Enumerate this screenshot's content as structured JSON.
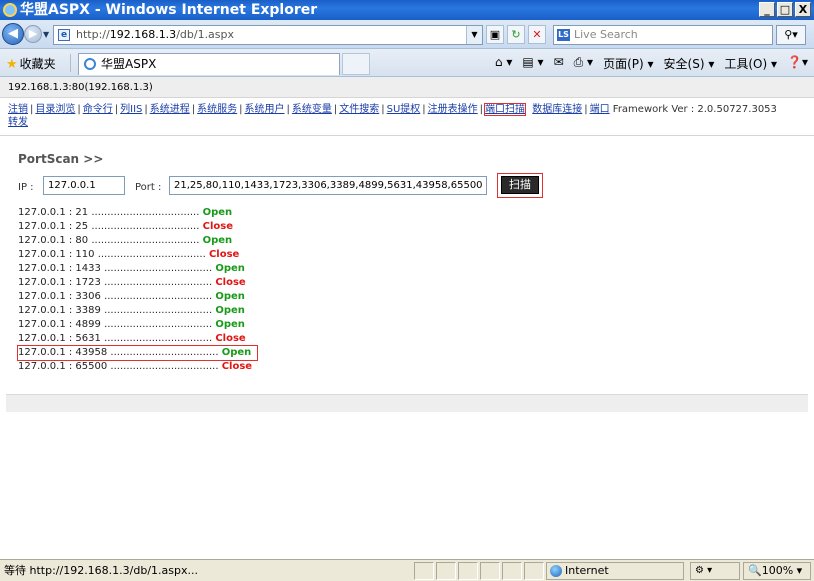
{
  "window": {
    "title": "华盟ASPX - Windows Internet Explorer",
    "min": "_",
    "max": "□",
    "close": "X"
  },
  "address": {
    "url_prefix": "http://",
    "url_host": "192.168.1.3",
    "url_path": "/db/1.aspx",
    "search_placeholder": "Live Search"
  },
  "tabs": {
    "favorites_label": "收藏夹",
    "tab_title": "华盟ASPX",
    "commands": [
      "页面(P) ▾",
      "安全(S) ▾",
      "工具(O) ▾"
    ]
  },
  "page": {
    "host_info": "192.168.1.3:80(192.168.1.3)",
    "menu": [
      "注销",
      "目录浏览",
      "命令行",
      "列IIS",
      "系统进程",
      "系统服务",
      "系统用户",
      "系统变量",
      "文件搜索",
      "SU提权",
      "注册表操作",
      "端口扫描",
      "数据库连接",
      "端口"
    ],
    "framework_version": "Framework Ver : 2.0.50727.3053",
    "menu_last": "转发",
    "scan": {
      "title": "PortScan >>",
      "ip_label": "IP :",
      "ip_value": "127.0.0.1",
      "port_label": "Port :",
      "port_value": "21,25,80,110,1433,1723,3306,3389,4899,5631,43958,65500",
      "button_label": "扫描"
    },
    "results": [
      {
        "target": "127.0.0.1 : 21 ..................................",
        "status": "Open"
      },
      {
        "target": "127.0.0.1 : 25 ..................................",
        "status": "Close"
      },
      {
        "target": "127.0.0.1 : 80 ..................................",
        "status": "Open"
      },
      {
        "target": "127.0.0.1 : 110 ..................................",
        "status": "Close"
      },
      {
        "target": "127.0.0.1 : 1433 ..................................",
        "status": "Open"
      },
      {
        "target": "127.0.0.1 : 1723 ..................................",
        "status": "Close"
      },
      {
        "target": "127.0.0.1 : 3306 ..................................",
        "status": "Open"
      },
      {
        "target": "127.0.0.1 : 3389 ..................................",
        "status": "Open"
      },
      {
        "target": "127.0.0.1 : 4899 ..................................",
        "status": "Open"
      },
      {
        "target": "127.0.0.1 : 5631 ..................................",
        "status": "Close"
      },
      {
        "target": "127.0.0.1 : 43958 ..................................",
        "status": "Open"
      },
      {
        "target": "127.0.0.1 : 65500 ..................................",
        "status": "Close"
      }
    ]
  },
  "status": {
    "text": "等待 http://192.168.1.3/db/1.aspx...",
    "zone": "Internet",
    "zoom": "100%",
    "protected": "▾"
  },
  "colors": {
    "open": "#1a9a1a",
    "close": "#e01616",
    "highlight_box": "#e23030",
    "link": "#1a3ea8"
  }
}
